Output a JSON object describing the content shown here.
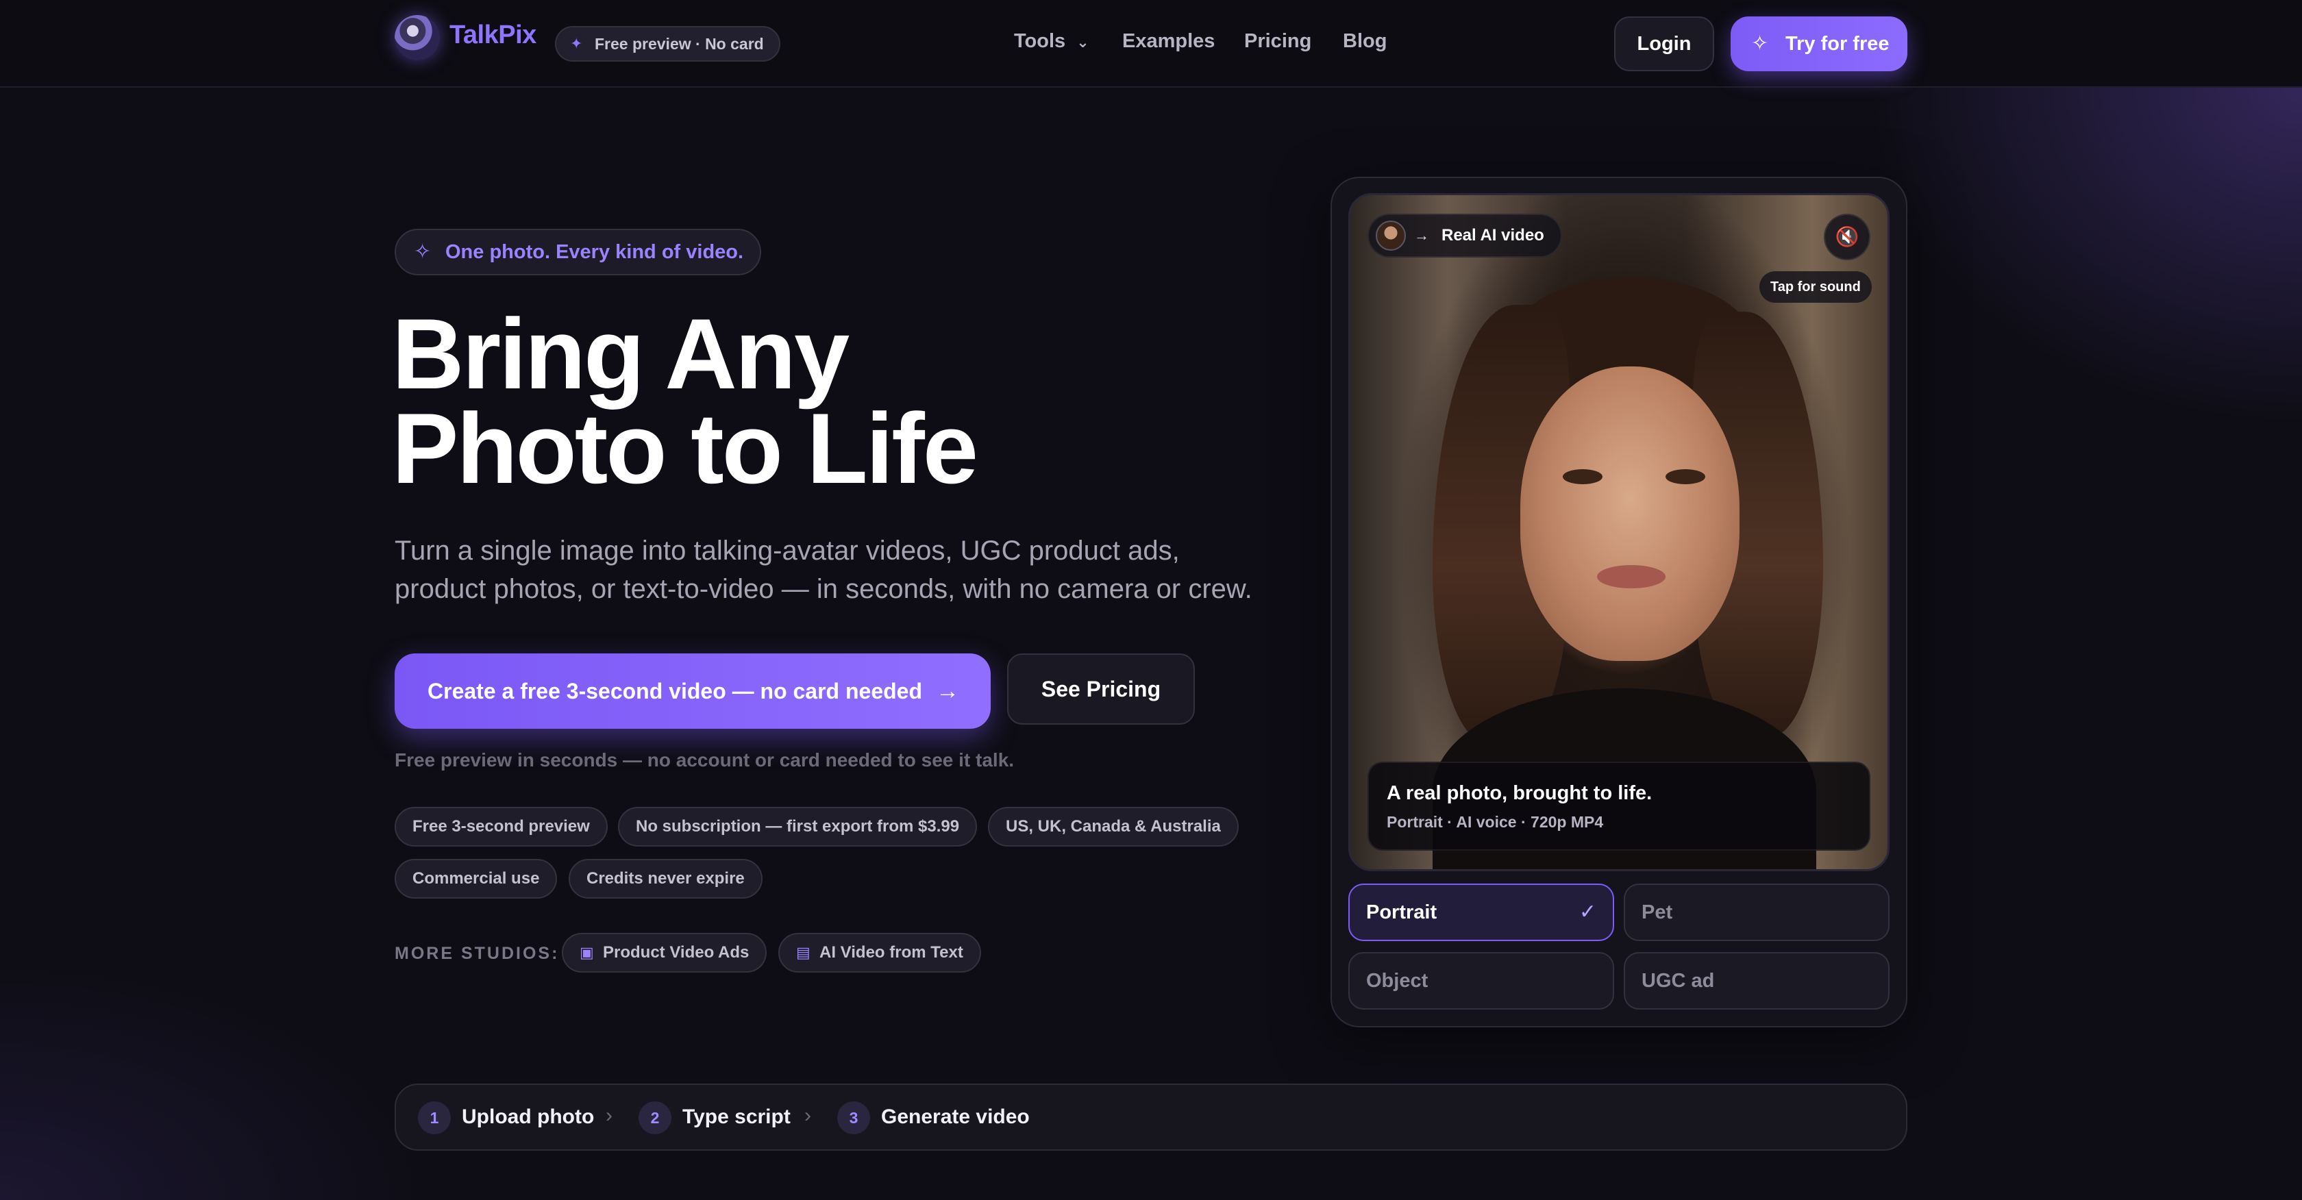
{
  "header": {
    "logo_text": "TalkPix",
    "free_pill": "Free preview · No card",
    "nav": [
      "Tools",
      "Examples",
      "Pricing",
      "Blog"
    ],
    "login": "Login",
    "try_free": "Try for free"
  },
  "hero": {
    "tagline": "One photo. Every kind of video.",
    "title_line1": "Bring Any",
    "title_line2": "Photo to Life",
    "subtitle": "Turn a single image into talking-avatar videos, UGC product ads, product photos, or text-to-video — in seconds, with no camera or crew.",
    "cta_primary": "Create a free 3-second video — no card needed",
    "cta_secondary": "See Pricing",
    "free_note": "Free preview in seconds — no account or card needed to see it talk.",
    "chips": [
      "Free 3-second preview",
      "No subscription — first export from $3.99",
      "US, UK, Canada & Australia",
      "Commercial use",
      "Credits never expire"
    ],
    "more_studios_label": "MORE STUDIOS:",
    "studios": [
      "Product Video Ads",
      "AI Video from Text"
    ]
  },
  "preview": {
    "badge": "Real AI video",
    "tap_sound": "Tap for sound",
    "caption_title": "A real photo, brought to life.",
    "caption_meta": "Portrait · AI voice · 720p MP4",
    "options": [
      "Portrait",
      "Pet",
      "Object",
      "UGC ad"
    ],
    "selected": "Portrait"
  },
  "steps": [
    {
      "num": "1",
      "label": "Upload photo"
    },
    {
      "num": "2",
      "label": "Type script"
    },
    {
      "num": "3",
      "label": "Generate video"
    }
  ],
  "colors": {
    "accent": "#8c6bff",
    "background": "#0e0d15"
  }
}
